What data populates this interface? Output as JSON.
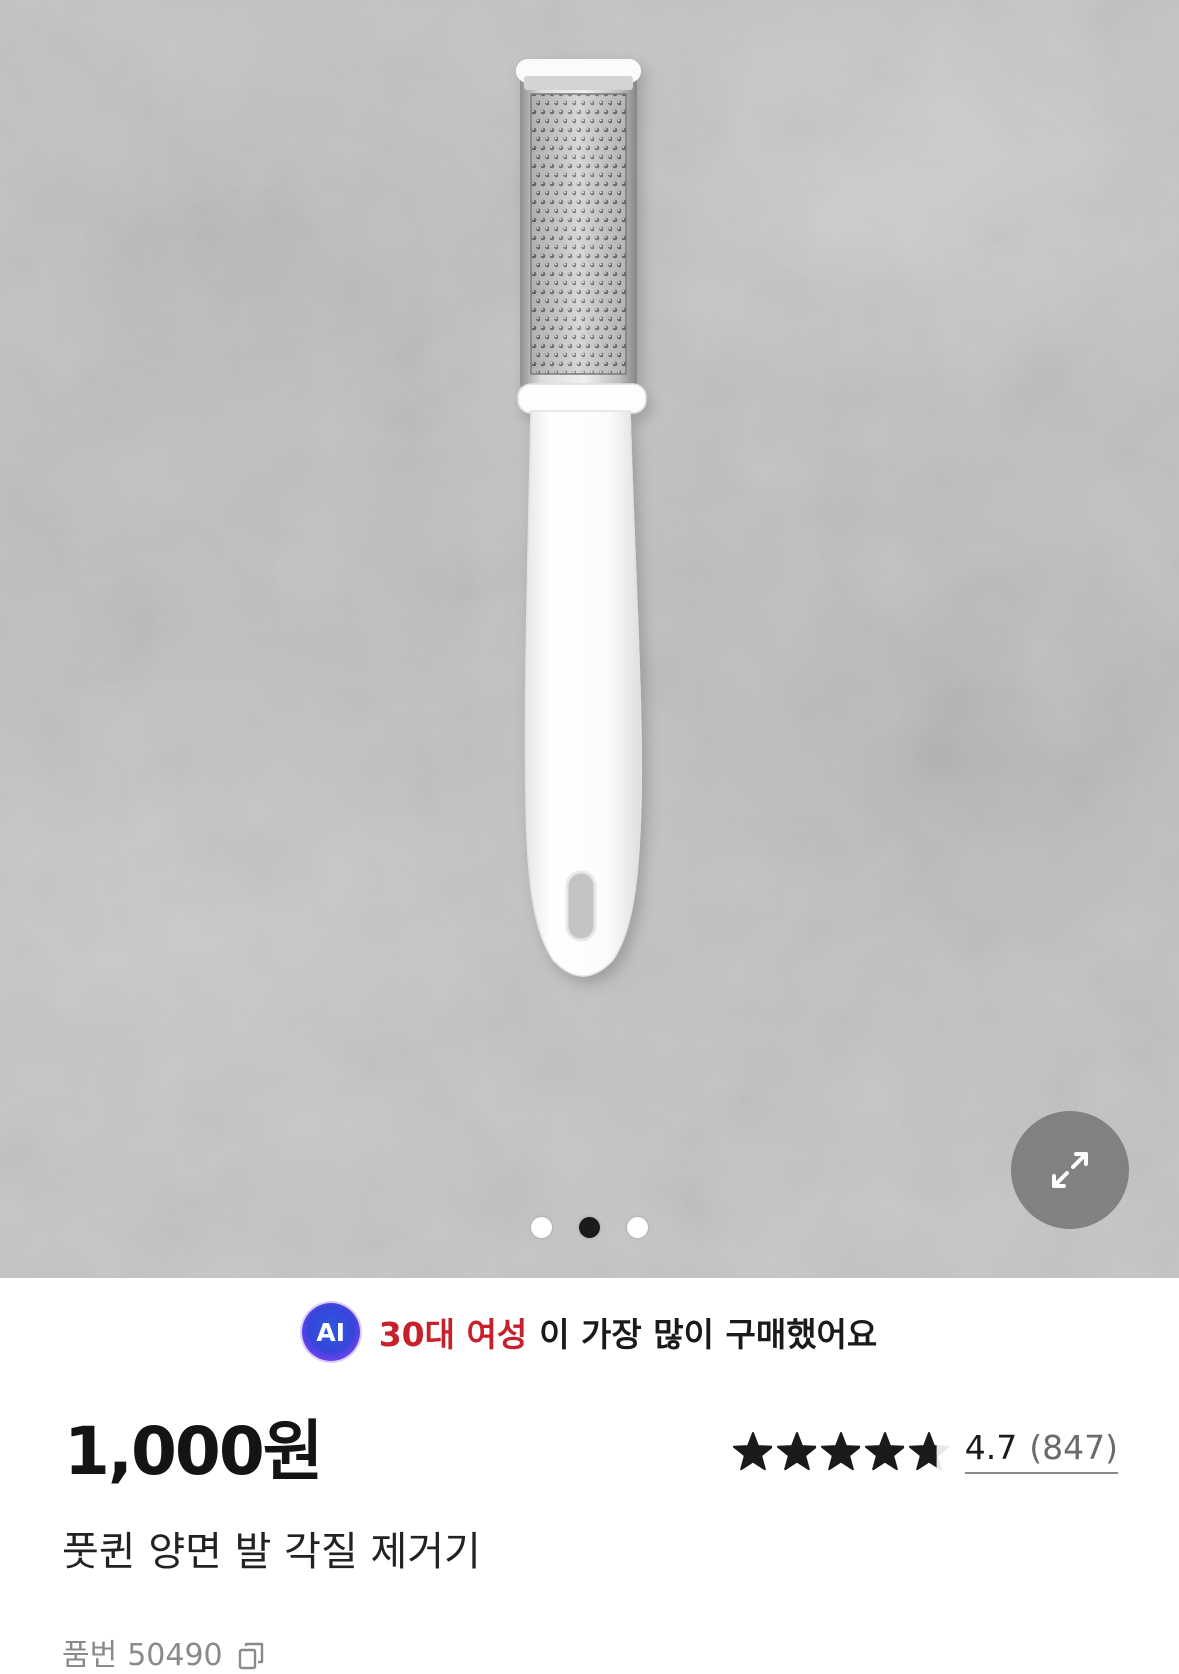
{
  "product_gallery": {
    "slide_count": 3,
    "active_slide": 2,
    "expand_icon": "expand-icon"
  },
  "ai_insight": {
    "badge": "AI",
    "highlight": "30대 여성",
    "text": "이 가장 많이 구매했어요"
  },
  "price": "1,000원",
  "rating": {
    "score": 4.7,
    "score_text": "4.7",
    "review_count": "(847)",
    "max_stars": 5,
    "star_icon": "star-icon"
  },
  "product_name": "풋퀸 양면 발 각질 제거기",
  "product_code": {
    "label": "품번",
    "value": "50490",
    "copy_icon": "copy-icon"
  },
  "colors": {
    "highlight_red": "#c8202a",
    "star_fill": "#1a1a1a",
    "star_empty": "#e8e8e8",
    "pager_active": "#1b1b1b",
    "pager_inactive": "#ffffff",
    "text_primary": "#141414",
    "text_secondary": "#8a8a8a"
  }
}
